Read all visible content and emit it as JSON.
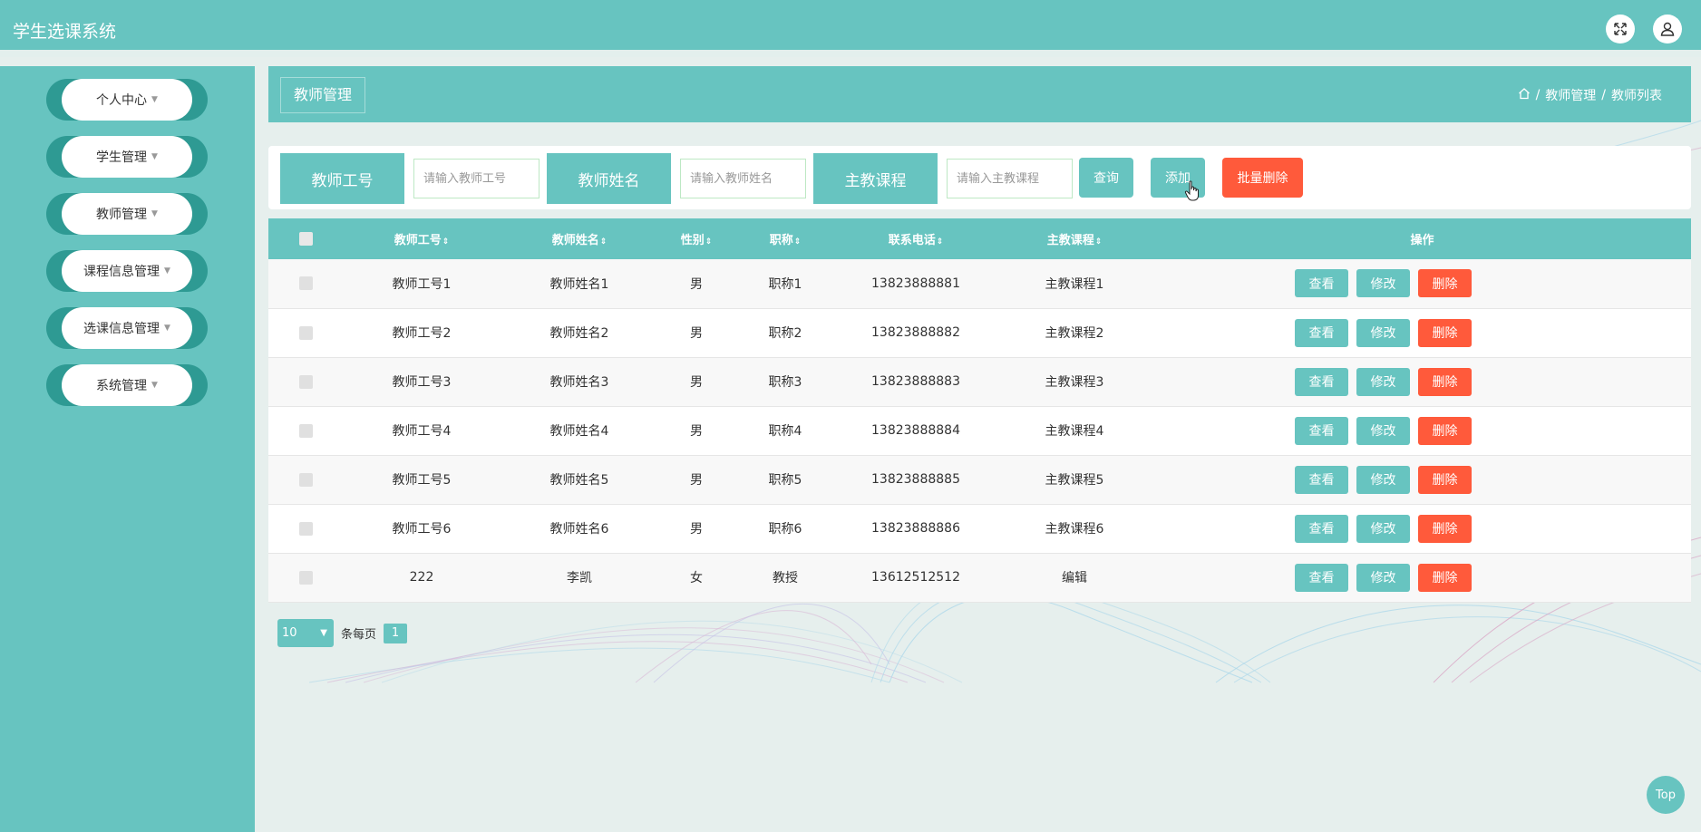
{
  "app": {
    "title": "学生选课系统"
  },
  "sidebar": {
    "items": [
      {
        "label": "个人中心"
      },
      {
        "label": "学生管理"
      },
      {
        "label": "教师管理"
      },
      {
        "label": "课程信息管理"
      },
      {
        "label": "选课信息管理"
      },
      {
        "label": "系统管理"
      }
    ]
  },
  "header": {
    "page_title": "教师管理",
    "breadcrumb": [
      "教师管理",
      "教师列表"
    ],
    "separator": "/"
  },
  "search": {
    "fields": [
      {
        "label": "教师工号",
        "placeholder": "请输入教师工号",
        "value": ""
      },
      {
        "label": "教师姓名",
        "placeholder": "请输入教师姓名",
        "value": ""
      },
      {
        "label": "主教课程",
        "placeholder": "请输入主教课程",
        "value": ""
      }
    ],
    "query_label": "查询",
    "add_label": "添加",
    "batch_delete_label": "批量删除"
  },
  "table": {
    "columns": [
      "教师工号",
      "教师姓名",
      "性别",
      "职称",
      "联系电话",
      "主教课程",
      "操作"
    ],
    "sort_glyph": "⇕",
    "rows": [
      {
        "id": "教师工号1",
        "name": "教师姓名1",
        "gender": "男",
        "title": "职称1",
        "phone": "13823888881",
        "course": "主教课程1"
      },
      {
        "id": "教师工号2",
        "name": "教师姓名2",
        "gender": "男",
        "title": "职称2",
        "phone": "13823888882",
        "course": "主教课程2"
      },
      {
        "id": "教师工号3",
        "name": "教师姓名3",
        "gender": "男",
        "title": "职称3",
        "phone": "13823888883",
        "course": "主教课程3"
      },
      {
        "id": "教师工号4",
        "name": "教师姓名4",
        "gender": "男",
        "title": "职称4",
        "phone": "13823888884",
        "course": "主教课程4"
      },
      {
        "id": "教师工号5",
        "name": "教师姓名5",
        "gender": "男",
        "title": "职称5",
        "phone": "13823888885",
        "course": "主教课程5"
      },
      {
        "id": "教师工号6",
        "name": "教师姓名6",
        "gender": "男",
        "title": "职称6",
        "phone": "13823888886",
        "course": "主教课程6"
      },
      {
        "id": "222",
        "name": "李凯",
        "gender": "女",
        "title": "教授",
        "phone": "13612512512",
        "course": "编辑"
      }
    ],
    "row_actions": {
      "view": "查看",
      "edit": "修改",
      "delete": "删除"
    }
  },
  "pagination": {
    "page_size": "10",
    "per_page_label": "条每页",
    "current_page": "1"
  },
  "back_to_top": "Top",
  "colors": {
    "primary": "#67c4c0",
    "danger": "#ff5a3b",
    "sidebar_pill": "#2e9a93"
  },
  "icons": {
    "fullscreen": "fullscreen-icon",
    "user": "user-icon",
    "home": "home-icon"
  }
}
